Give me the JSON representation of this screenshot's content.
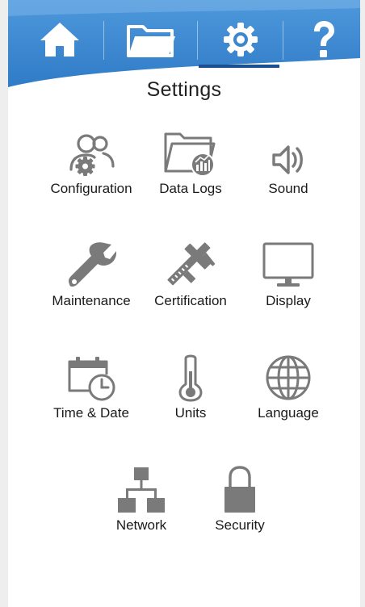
{
  "nav": {
    "items": [
      {
        "name": "home",
        "icon": "home-icon"
      },
      {
        "name": "files",
        "icon": "folder-icon"
      },
      {
        "name": "settings",
        "icon": "gear-icon",
        "active": true
      },
      {
        "name": "help",
        "icon": "question-icon"
      }
    ],
    "colors": {
      "bar": "#3b86cf",
      "bar_light": "#5ea3e0",
      "icon": "#ffffff",
      "active_underline": "#1b4f94"
    }
  },
  "page": {
    "title": "Settings"
  },
  "settings_grid": {
    "icon_color": "#7a7a7a",
    "items": [
      {
        "label": "Configuration",
        "icon": "users-gear-icon"
      },
      {
        "label": "Data Logs",
        "icon": "folder-chart-icon"
      },
      {
        "label": "Sound",
        "icon": "speaker-icon"
      },
      {
        "label": "Maintenance",
        "icon": "wrench-icon"
      },
      {
        "label": "Certification",
        "icon": "caliper-icon"
      },
      {
        "label": "Display",
        "icon": "monitor-icon"
      },
      {
        "label": "Time & Date",
        "icon": "calendar-clock-icon"
      },
      {
        "label": "Units",
        "icon": "thermometer-icon"
      },
      {
        "label": "Language",
        "icon": "globe-icon"
      },
      {
        "label": "Network",
        "icon": "network-icon"
      },
      {
        "label": "Security",
        "icon": "lock-icon"
      }
    ]
  }
}
